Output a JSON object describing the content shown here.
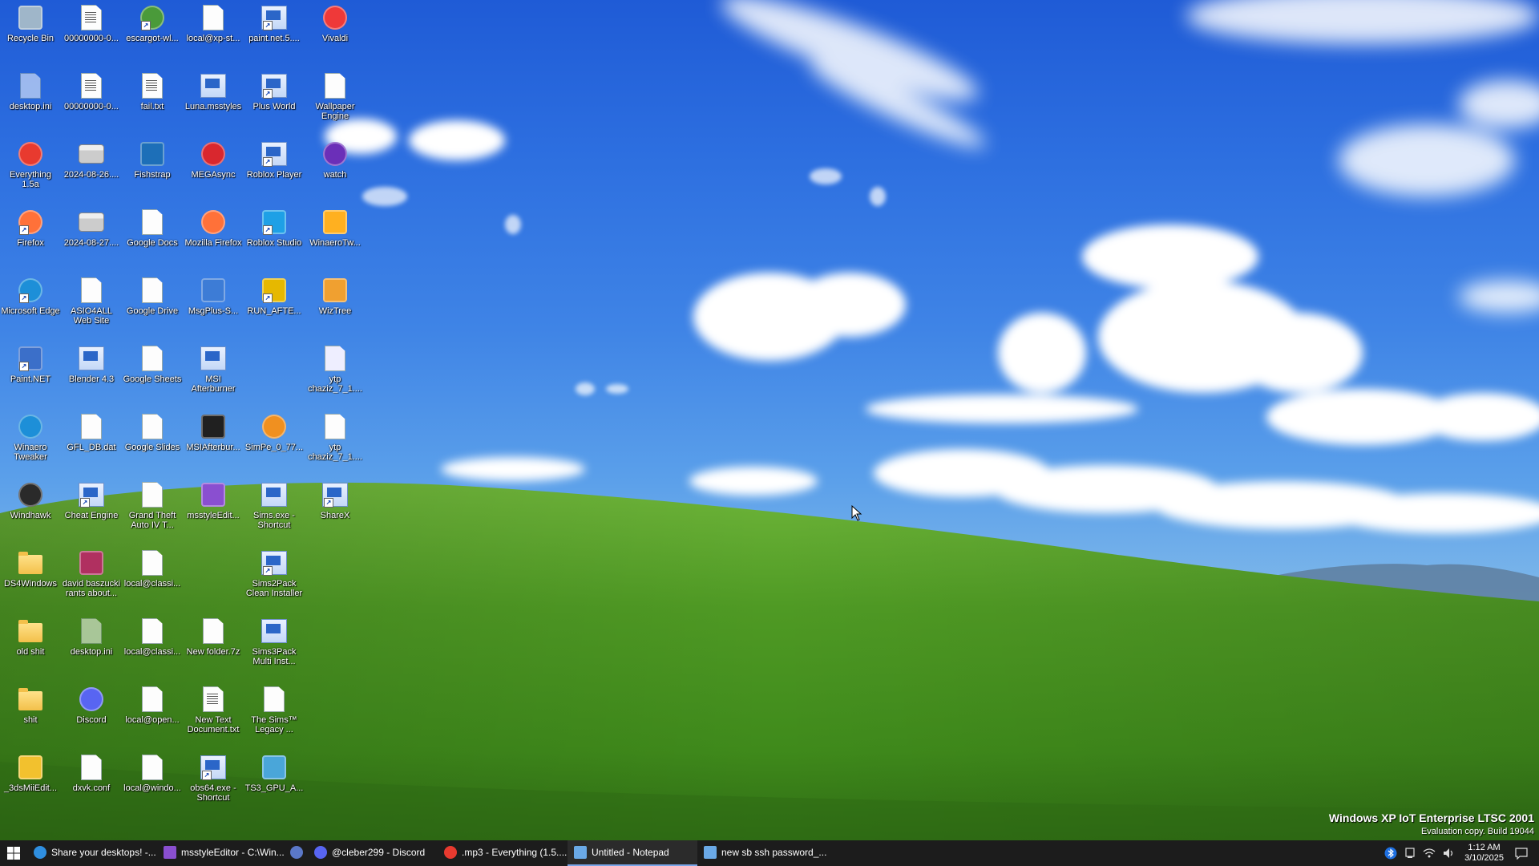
{
  "desktop": {
    "icons": [
      {
        "label": "Recycle Bin",
        "icon": "recycle-bin-icon",
        "kind": "bin",
        "col": 0,
        "row": 0
      },
      {
        "label": "00000000-0...",
        "icon": "text-file-icon",
        "kind": "doc",
        "col": 1,
        "row": 0
      },
      {
        "label": "escargot-wl...",
        "icon": "escargot-icon",
        "kind": "globe",
        "col": 2,
        "row": 0
      },
      {
        "label": "local@xp-st...",
        "icon": "blank-file-icon",
        "kind": "file",
        "col": 3,
        "row": 0
      },
      {
        "label": "paint.net.5....",
        "icon": "paintnet-installer-icon",
        "kind": "shortcut",
        "col": 4,
        "row": 0
      },
      {
        "label": "Vivaldi",
        "icon": "vivaldi-icon",
        "kind": "vivaldi",
        "col": 5,
        "row": 0
      },
      {
        "label": "desktop.ini",
        "icon": "settings-file-icon",
        "kind": "faded",
        "col": 0,
        "row": 1
      },
      {
        "label": "00000000-0...",
        "icon": "text-file-icon",
        "kind": "doc",
        "col": 1,
        "row": 1
      },
      {
        "label": "fail.txt",
        "icon": "text-file-icon",
        "kind": "doc",
        "col": 2,
        "row": 1
      },
      {
        "label": "Luna.msstyles",
        "icon": "msstyles-icon",
        "kind": "shortcut",
        "col": 3,
        "row": 1
      },
      {
        "label": "Plus World",
        "icon": "shortcut-file-icon",
        "kind": "shortcut",
        "col": 4,
        "row": 1
      },
      {
        "label": "Wallpaper Engine",
        "icon": "blank-file-icon",
        "kind": "file",
        "col": 5,
        "row": 1
      },
      {
        "label": "Everything 1.5a",
        "icon": "everything-search-icon",
        "kind": "everything",
        "col": 0,
        "row": 2
      },
      {
        "label": "2024-08-26....",
        "icon": "image-file-icon",
        "kind": "image",
        "col": 1,
        "row": 2
      },
      {
        "label": "Fishstrap",
        "icon": "fishstrap-icon",
        "kind": "fishstrap",
        "col": 2,
        "row": 2
      },
      {
        "label": "MEGAsync",
        "icon": "mega-icon",
        "kind": "mega",
        "col": 3,
        "row": 2
      },
      {
        "label": "Roblox Player",
        "icon": "shortcut-file-icon",
        "kind": "shortcut",
        "col": 4,
        "row": 2
      },
      {
        "label": "watch",
        "icon": "watch-icon",
        "kind": "watch",
        "col": 5,
        "row": 2
      },
      {
        "label": "Firefox",
        "icon": "firefox-icon",
        "kind": "firefox",
        "col": 0,
        "row": 3
      },
      {
        "label": "2024-08-27....",
        "icon": "image-file-icon",
        "kind": "image",
        "col": 1,
        "row": 3
      },
      {
        "label": "Google Docs",
        "icon": "blank-file-icon",
        "kind": "file",
        "col": 2,
        "row": 3
      },
      {
        "label": "Mozilla Firefox",
        "icon": "firefox-icon",
        "kind": "firefox",
        "col": 3,
        "row": 3
      },
      {
        "label": "Roblox Studio",
        "icon": "roblox-studio-icon",
        "kind": "studio",
        "col": 4,
        "row": 3
      },
      {
        "label": "WinaeroTw...",
        "icon": "winaero-icon",
        "kind": "winaero",
        "col": 5,
        "row": 3
      },
      {
        "label": "Microsoft Edge",
        "icon": "edge-icon",
        "kind": "edge",
        "col": 0,
        "row": 4
      },
      {
        "label": "ASIO4ALL Web Site",
        "icon": "blank-file-icon",
        "kind": "file",
        "col": 1,
        "row": 4
      },
      {
        "label": "Google Drive",
        "icon": "blank-file-icon",
        "kind": "file",
        "col": 2,
        "row": 4
      },
      {
        "label": "MsgPlus-S...",
        "icon": "msgplus-icon",
        "kind": "msgplus",
        "col": 3,
        "row": 4
      },
      {
        "label": "RUN_AFTE...",
        "icon": "setup-icon",
        "kind": "setup",
        "col": 4,
        "row": 4
      },
      {
        "label": "WizTree",
        "icon": "wiztree-icon",
        "kind": "wiztree",
        "col": 5,
        "row": 4
      },
      {
        "label": "Paint.NET",
        "icon": "paintnet-icon",
        "kind": "paint",
        "col": 0,
        "row": 5
      },
      {
        "label": "Blender 4.3",
        "icon": "shortcut-file-icon",
        "kind": "shortcut",
        "col": 1,
        "row": 5
      },
      {
        "label": "Google Sheets",
        "icon": "blank-file-icon",
        "kind": "file",
        "col": 2,
        "row": 5
      },
      {
        "label": "MSI Afterburner",
        "icon": "shortcut-file-icon",
        "kind": "shortcut",
        "col": 3,
        "row": 5
      },
      {
        "label": "ytp chaziz_7_1....",
        "icon": "audio-file-icon",
        "kind": "audio",
        "col": 5,
        "row": 5
      },
      {
        "label": "Winaero Tweaker",
        "icon": "winaero-tweaker-icon",
        "kind": "edge",
        "col": 0,
        "row": 6
      },
      {
        "label": "GFL_DB.dat",
        "icon": "blank-file-icon",
        "kind": "file",
        "col": 1,
        "row": 6
      },
      {
        "label": "Google Slides",
        "icon": "blank-file-icon",
        "kind": "file",
        "col": 2,
        "row": 6
      },
      {
        "label": "MSIAfterbur...",
        "icon": "msi-afterburner-icon",
        "kind": "msi",
        "col": 3,
        "row": 6
      },
      {
        "label": "SimPe_0_77...",
        "icon": "simpe-icon",
        "kind": "simpe",
        "col": 4,
        "row": 6
      },
      {
        "label": "ytp chaziz_7_1....",
        "icon": "blank-file-icon",
        "kind": "file",
        "col": 5,
        "row": 6
      },
      {
        "label": "Windhawk",
        "icon": "windhawk-icon",
        "kind": "windhawk",
        "col": 0,
        "row": 7
      },
      {
        "label": "Cheat Engine",
        "icon": "shortcut-file-icon",
        "kind": "shortcut",
        "col": 1,
        "row": 7
      },
      {
        "label": "Grand Theft Auto IV T...",
        "icon": "blank-file-icon",
        "kind": "file",
        "col": 2,
        "row": 7
      },
      {
        "label": "msstyleEdit...",
        "icon": "msstyleeditor-icon",
        "kind": "msstyle",
        "col": 3,
        "row": 7
      },
      {
        "label": "Sims.exe - Shortcut",
        "icon": "shortcut-file-icon",
        "kind": "shortcut",
        "col": 4,
        "row": 7
      },
      {
        "label": "ShareX",
        "icon": "shortcut-file-icon",
        "kind": "shortcut",
        "col": 5,
        "row": 7
      },
      {
        "label": "DS4Windows",
        "icon": "folder-icon",
        "kind": "folder",
        "col": 0,
        "row": 8
      },
      {
        "label": "david baszucki rants about...",
        "icon": "video-file-icon",
        "kind": "video",
        "col": 1,
        "row": 8
      },
      {
        "label": "local@classi...",
        "icon": "blank-file-icon",
        "kind": "file",
        "col": 2,
        "row": 8
      },
      {
        "label": "Sims2Pack Clean Installer",
        "icon": "shortcut-file-icon",
        "kind": "shortcut",
        "col": 4,
        "row": 8
      },
      {
        "label": "old shit",
        "icon": "folder-icon",
        "kind": "folder",
        "col": 0,
        "row": 9
      },
      {
        "label": "desktop.ini",
        "icon": "settings-file-icon",
        "kind": "faded",
        "col": 1,
        "row": 9
      },
      {
        "label": "local@classi...",
        "icon": "blank-file-icon",
        "kind": "file",
        "col": 2,
        "row": 9
      },
      {
        "label": "New folder.7z",
        "icon": "blank-file-icon",
        "kind": "file",
        "col": 3,
        "row": 9
      },
      {
        "label": "Sims3Pack Multi Inst...",
        "icon": "shortcut-file-icon",
        "kind": "shortcut",
        "col": 4,
        "row": 9
      },
      {
        "label": "shit",
        "icon": "folder-icon",
        "kind": "folder",
        "col": 0,
        "row": 10
      },
      {
        "label": "Discord",
        "icon": "discord-icon",
        "kind": "discord",
        "col": 1,
        "row": 10
      },
      {
        "label": "local@open...",
        "icon": "blank-file-icon",
        "kind": "file",
        "col": 2,
        "row": 10
      },
      {
        "label": "New Text Document.txt",
        "icon": "text-file-icon",
        "kind": "doc",
        "col": 3,
        "row": 10
      },
      {
        "label": "The Sims™ Legacy ...",
        "icon": "blank-file-icon",
        "kind": "file",
        "col": 4,
        "row": 10
      },
      {
        "label": "_3dsMiiEdit...",
        "icon": "mii-editor-icon",
        "kind": "mii",
        "col": 0,
        "row": 11
      },
      {
        "label": "dxvk.conf",
        "icon": "blank-file-icon",
        "kind": "file",
        "col": 1,
        "row": 11
      },
      {
        "label": "local@windo...",
        "icon": "blank-file-icon",
        "kind": "file",
        "col": 2,
        "row": 11
      },
      {
        "label": "obs64.exe - Shortcut",
        "icon": "shortcut-file-icon",
        "kind": "shortcut",
        "col": 3,
        "row": 11
      },
      {
        "label": "TS3_GPU_A...",
        "icon": "sims3-icon",
        "kind": "sims3",
        "col": 4,
        "row": 11
      }
    ]
  },
  "watermark": {
    "title": "Windows XP IoT Enterprise LTSC 2001",
    "build": "Evaluation copy. Build 19044"
  },
  "taskbar": {
    "start_icon": "windows-logo-icon",
    "items": [
      {
        "label": "Share your desktops! -...",
        "icon": "edge-icon",
        "color": "#2f8fe0",
        "active": false
      },
      {
        "label": "msstyleEditor - C:\\Win...",
        "icon": "msstyleeditor-icon",
        "color": "#8a4fd0",
        "active": false
      },
      {
        "label": "",
        "icon": "globe-app-icon",
        "color": "#5b78c8",
        "active": false
      },
      {
        "label": "@cleber299 - Discord",
        "icon": "discord-icon",
        "color": "#5865f2",
        "active": false
      },
      {
        "label": ".mp3 - Everything (1.5....",
        "icon": "everything-search-icon",
        "color": "#e83a2f",
        "active": false
      },
      {
        "label": "Untitled - Notepad",
        "icon": "notepad-icon",
        "color": "#6aa9e6",
        "active": true
      },
      {
        "label": "new sb ssh password_....",
        "icon": "notepad-icon",
        "color": "#6aa9e6",
        "active": false
      }
    ],
    "tray_icons": [
      "bluetooth-icon",
      "device-icon",
      "network-icon",
      "volume-icon"
    ],
    "clock_time": "1:12 AM",
    "clock_date": "3/10/2025",
    "notification_icon": "notification-icon"
  }
}
